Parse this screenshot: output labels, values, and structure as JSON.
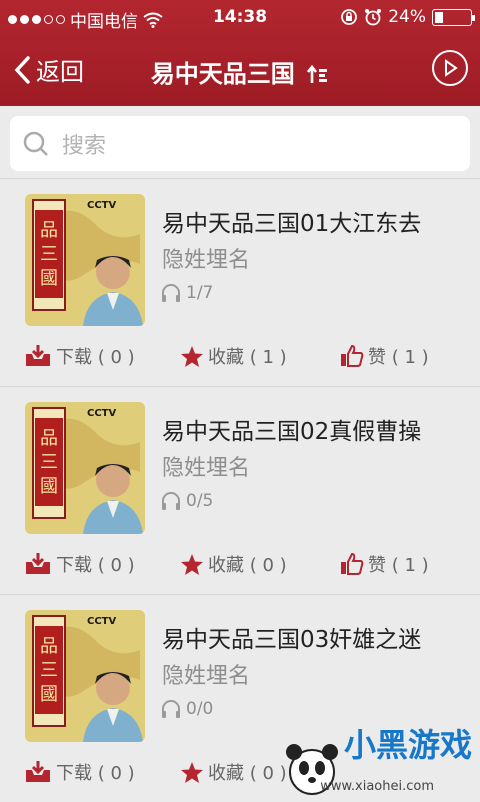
{
  "status_bar": {
    "carrier": "中国电信",
    "time": "14:38",
    "battery": "24%",
    "battery_level": 0.24
  },
  "nav": {
    "back_label": "返回",
    "title": "易中天品三国"
  },
  "search": {
    "placeholder": "搜索"
  },
  "items": [
    {
      "title": "易中天品三国01大江东去",
      "artist": "隐姓埋名",
      "plays": "1/7",
      "download": "下载 ( 0 )",
      "favorite": "收藏 ( 1 )",
      "like": "赞 ( 1 )"
    },
    {
      "title": "易中天品三国02真假曹操",
      "artist": "隐姓埋名",
      "plays": "0/5",
      "download": "下载 ( 0 )",
      "favorite": "收藏 ( 0 )",
      "like": "赞 ( 1 )"
    },
    {
      "title": "易中天品三国03奸雄之迷",
      "artist": "隐姓埋名",
      "plays": "0/0",
      "download": "下载 ( 0 )",
      "favorite": "收藏 ( 0 )",
      "like": ""
    }
  ],
  "cover": {
    "brand": "CCTV",
    "series_title": "品三國"
  },
  "watermark": {
    "text": "小黑游戏",
    "url": "www.xiaohei.com"
  },
  "colors": {
    "header": "#a8212a",
    "accent": "#b3262f"
  }
}
